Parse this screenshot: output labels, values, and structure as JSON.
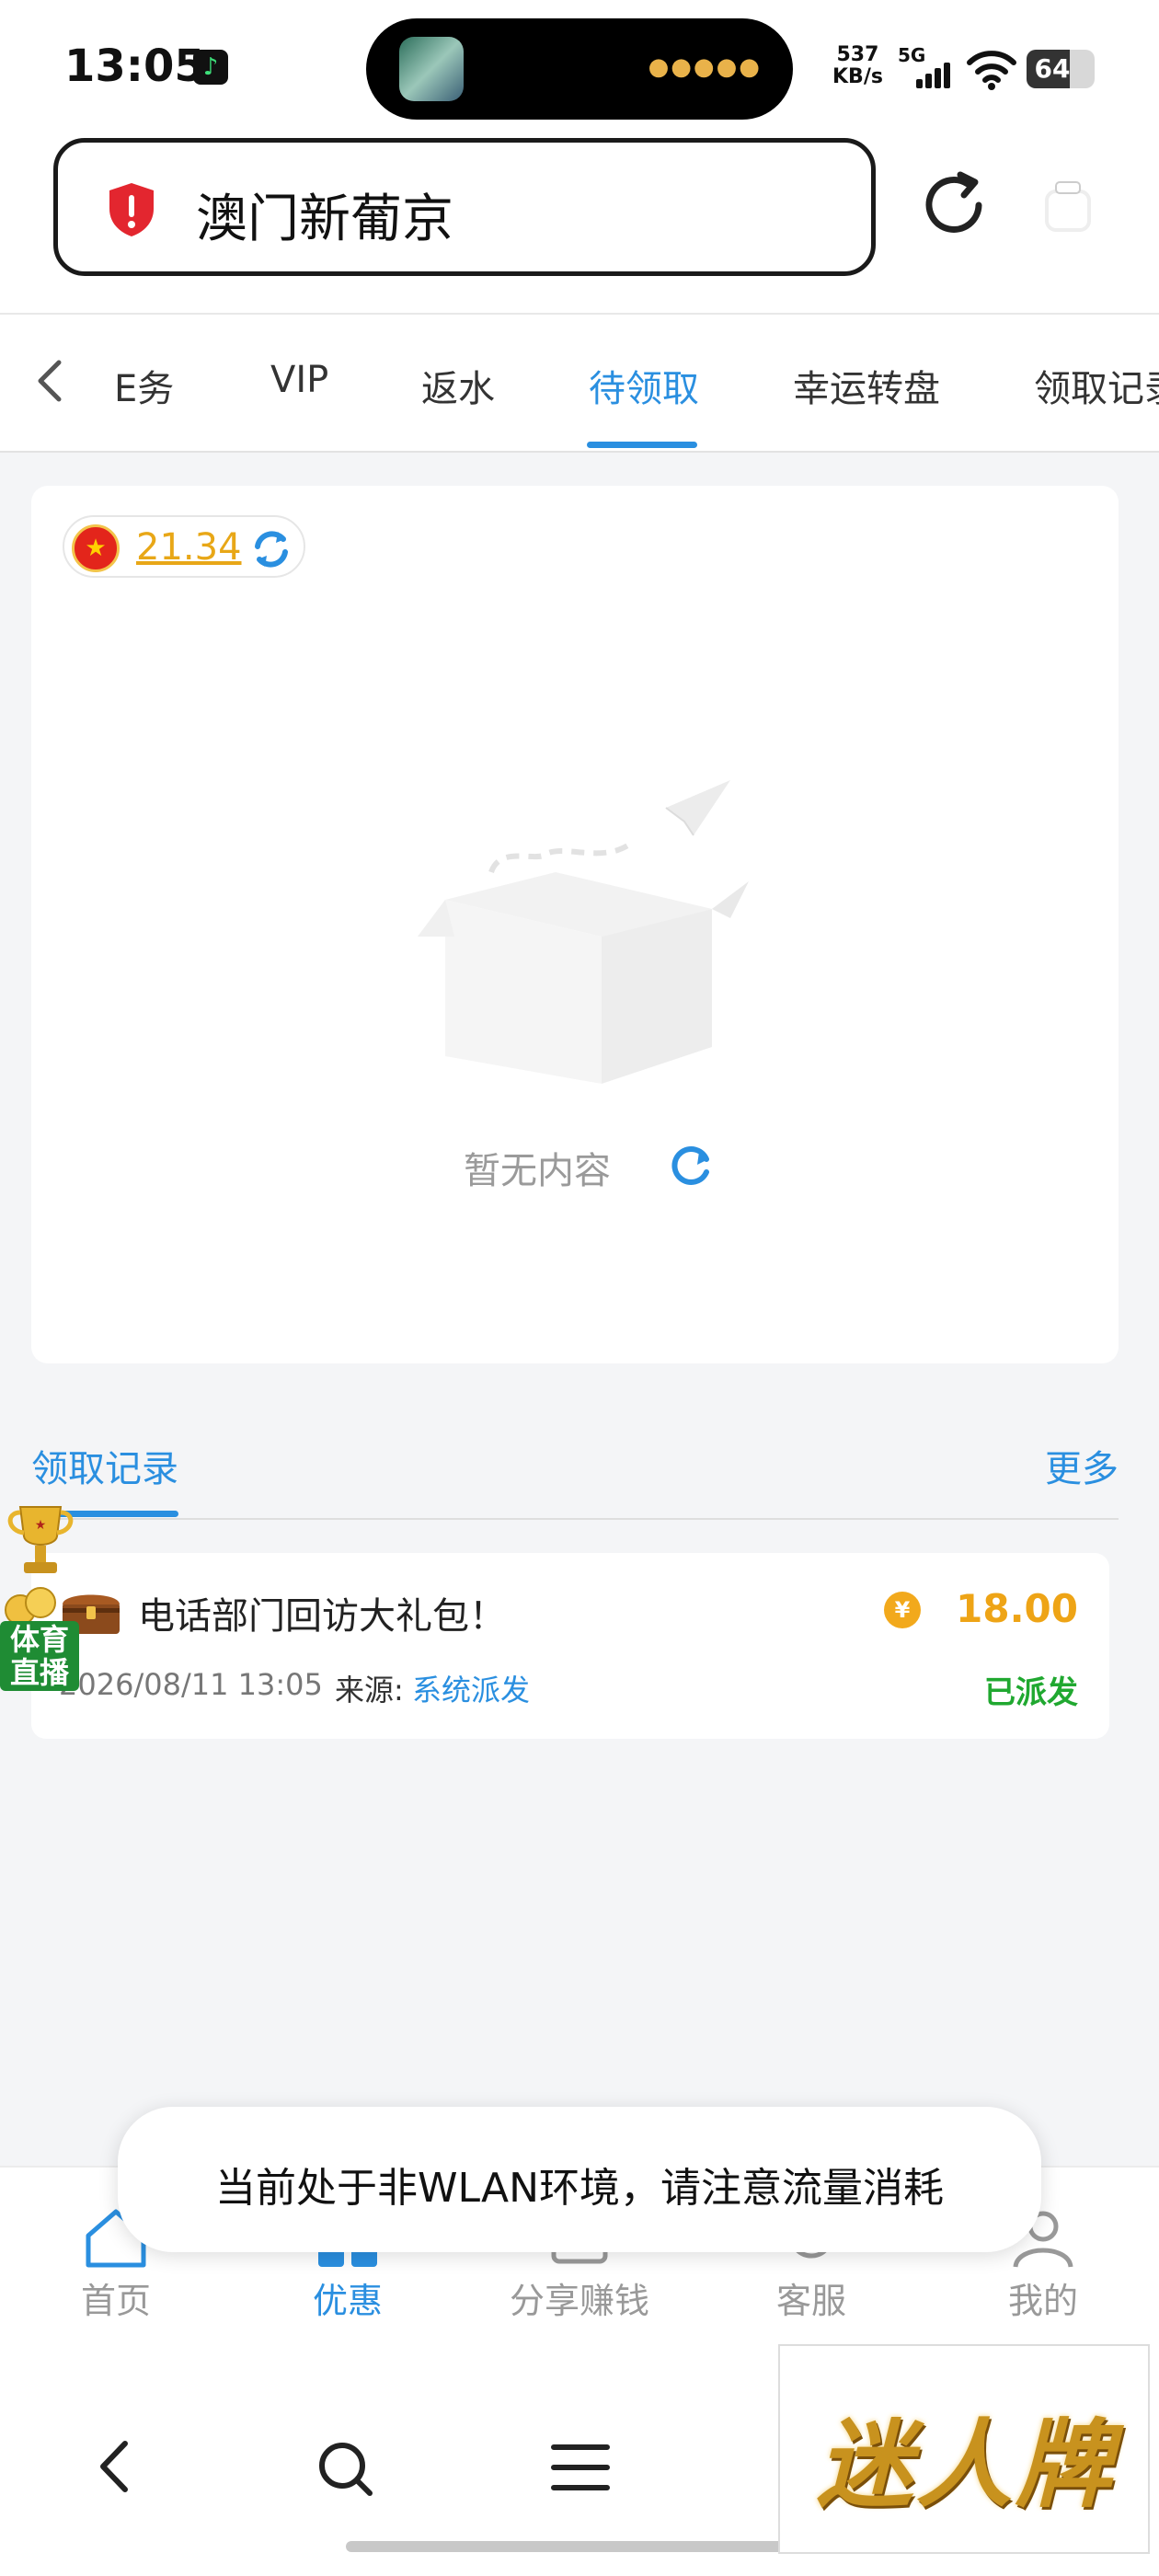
{
  "status_bar": {
    "time": "13:05",
    "net_speed_value": "537",
    "net_speed_unit": "KB/s",
    "signal_label": "5G",
    "battery": "64",
    "battery_level": 0.64
  },
  "address_bar": {
    "title": "澳门新葡京",
    "security_color": "#e3262f"
  },
  "tabs": [
    {
      "label": "E务"
    },
    {
      "label": "VIP"
    },
    {
      "label": "返水"
    },
    {
      "label": "待领取",
      "active": true
    },
    {
      "label": "幸运转盘"
    },
    {
      "label": "领取记录"
    }
  ],
  "wallet": {
    "balance": "21.34"
  },
  "empty_state": {
    "text": "暂无内容"
  },
  "records": {
    "title": "领取记录",
    "more": "更多",
    "items": [
      {
        "name": "电话部门回访大礼包！",
        "amount": "18.00",
        "coin_symbol": "¥",
        "date": "2026/08/11 13:05",
        "source_label": "来源:",
        "source": "系统派发",
        "status": "已派发"
      }
    ]
  },
  "sports_badge": {
    "line1": "体育",
    "line2": "直播"
  },
  "bottom_nav": [
    {
      "label": "首页"
    },
    {
      "label": "优惠",
      "active": true
    },
    {
      "label": "分享赚钱"
    },
    {
      "label": "客服"
    },
    {
      "label": "我的"
    }
  ],
  "toast": {
    "text": "当前处于非WLAN环境，请注意流量消耗"
  },
  "watermark": {
    "text": "迷人牌"
  },
  "colors": {
    "accent": "#2a8fe0",
    "gold": "#eea416",
    "success": "#20a830"
  }
}
